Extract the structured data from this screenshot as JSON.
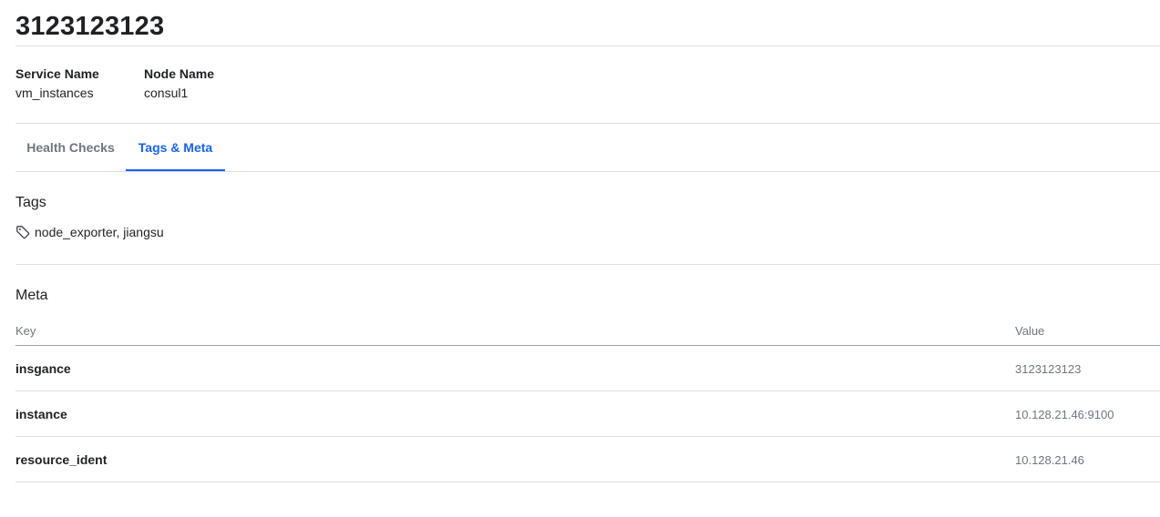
{
  "header": {
    "title": "3123123123"
  },
  "info": {
    "service": {
      "label": "Service Name",
      "value": "vm_instances"
    },
    "node": {
      "label": "Node Name",
      "value": "consul1"
    }
  },
  "tabs": [
    {
      "label": "Health Checks",
      "active": false
    },
    {
      "label": "Tags & Meta",
      "active": true
    }
  ],
  "tags_section": {
    "title": "Tags",
    "icon": "tag-icon",
    "value": "node_exporter, jiangsu"
  },
  "meta_section": {
    "title": "Meta",
    "columns": {
      "key": "Key",
      "value": "Value"
    },
    "rows": [
      {
        "key": "insgance",
        "value": "3123123123"
      },
      {
        "key": "instance",
        "value": "10.128.21.46:9100"
      },
      {
        "key": "resource_ident",
        "value": "10.128.21.46"
      }
    ]
  },
  "colors": {
    "accent": "#1563ff",
    "text": "#1f2124",
    "muted": "#6f7682",
    "divider": "#dcdfe3"
  }
}
